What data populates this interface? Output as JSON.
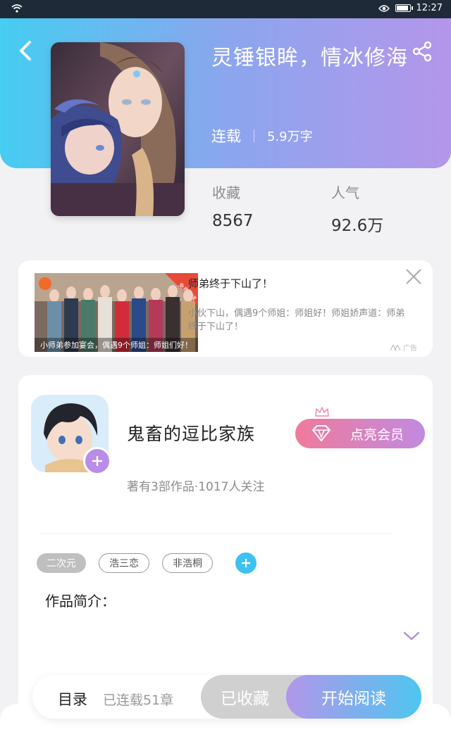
{
  "status_bar": {
    "time": "12:27"
  },
  "book": {
    "title": "灵锤银眸，情冰修海",
    "serial_status": "连载",
    "word_count": "5.9万字",
    "stats": [
      {
        "label": "收藏",
        "value": "8567"
      },
      {
        "label": "人气",
        "value": "92.6万"
      }
    ]
  },
  "ad": {
    "title": "师弟终于下山了！",
    "description": "小伙下山，偶遇9个师姐：师姐好！师姐娇声道：师弟终于下山了！",
    "image_caption": "小师弟参加宴会，偶遇9个师姐：师姐们好！",
    "corner_ribbon": "免费阅读",
    "badge": "广告"
  },
  "author": {
    "name": "鬼畜的逗比家族",
    "meta": "著有3部作品·1017人关注",
    "vip_button": "点亮会员"
  },
  "tags": [
    "二次元",
    "浩三恋",
    "非浩桐"
  ],
  "intro_label": "作品简介：",
  "bottom_bar": {
    "toc_label": "目录",
    "chapter_count": "已连载51章",
    "collected_label": "已收藏",
    "read_label": "开始阅读"
  },
  "colors": {
    "hero_gradient_start": "#45cdf2",
    "hero_gradient_end": "#b496ea",
    "vip_gradient_start": "#f07a9b",
    "vip_gradient_end": "#c18ae0",
    "tag_add": "#3cc1f0",
    "follow_button": "#b98ce8"
  }
}
